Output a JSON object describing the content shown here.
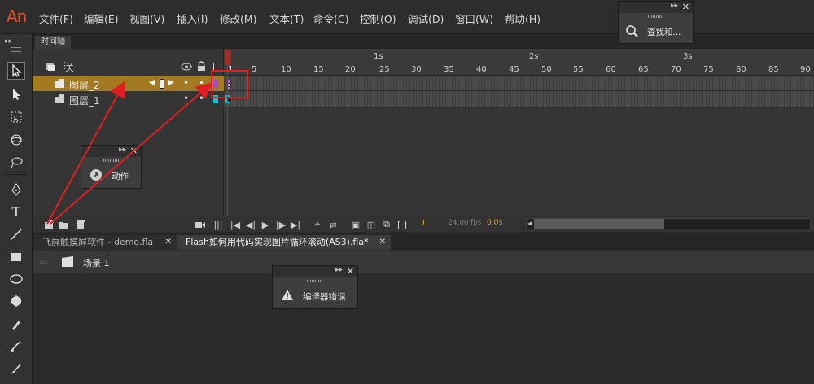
{
  "app": {
    "logo": "An",
    "accent": "#e0522e",
    "menu": [
      "文件(F)",
      "编辑(E)",
      "视图(V)",
      "插入(I)",
      "修改(M)",
      "文本(T)",
      "命令(C)",
      "控制(O)",
      "调试(D)",
      "窗口(W)",
      "帮助(H)"
    ]
  },
  "timeline": {
    "tab_label": "时间轴",
    "header_label": "关",
    "seconds": [
      "1s",
      "2s",
      "3s"
    ],
    "frame_numbers": [
      "1",
      "5",
      "10",
      "15",
      "20",
      "25",
      "30",
      "35",
      "40",
      "45",
      "50",
      "55",
      "60",
      "65",
      "70",
      "75",
      "80",
      "85",
      "90"
    ],
    "layers": [
      {
        "name": "图层_2",
        "selected": true,
        "color": "#a37a1f"
      },
      {
        "name": "图层_1",
        "selected": false,
        "color": "#00c8d8"
      }
    ],
    "current_frame": "1",
    "fps": "24.00",
    "fps_unit": "fps",
    "time": "0.0",
    "time_unit": "s"
  },
  "documents": {
    "tabs": [
      {
        "label": "飞屏触摸屏软件 - demo.fla",
        "active": false
      },
      {
        "label": "Flash如何用代码实现图片循环滚动(AS3).fla*",
        "active": true
      }
    ],
    "close_glyph": "✕"
  },
  "scene": {
    "label": "场景 1"
  },
  "panels": {
    "find_replace": "查找和...",
    "actions": "动作",
    "compiler_errors": "编译器错误",
    "close_glyph": "✕",
    "expand_glyph": "▸▸"
  },
  "annotation": {
    "color": "#e02020"
  }
}
